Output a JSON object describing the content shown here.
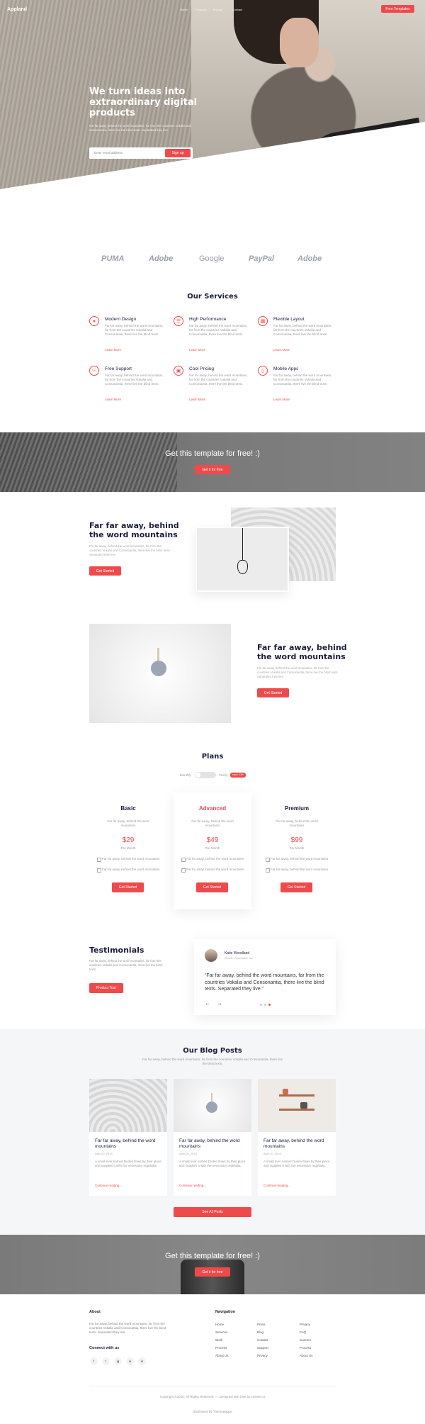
{
  "header": {
    "logo": "Appland",
    "nav": [
      "Home",
      "Features",
      "Pricing",
      "Contact"
    ],
    "cta": "Free Templates"
  },
  "hero": {
    "title": "We turn ideas into extraordinary digital products",
    "subtitle": "Far far away, behind the word mountains, far from the countries Vokalia and Consonantia, there live the blind texts. Separated they live.",
    "email_placeholder": "Enter email address",
    "button": "Sign up"
  },
  "brands": [
    "PUMA",
    "Adobe",
    "Google",
    "PayPal",
    "Adobe"
  ],
  "services": {
    "title": "Our Services",
    "items": [
      {
        "title": "Modern Design",
        "desc": "Far far away, behind the word mountains, far from the countries Vokalia and Consonantia, there live the blind texts.",
        "link": "Learn More"
      },
      {
        "title": "High Performance",
        "desc": "Far far away, behind the word mountains, far from the countries Vokalia and Consonantia, there live the blind texts.",
        "link": "Learn More"
      },
      {
        "title": "Flexible Layout",
        "desc": "Far far away, behind the word mountains, far from the countries Vokalia and Consonantia, there live the blind texts.",
        "link": "Learn More"
      },
      {
        "title": "Free Support",
        "desc": "Far far away, behind the word mountains, far from the countries Vokalia and Consonantia, there live the blind texts.",
        "link": "Learn More"
      },
      {
        "title": "Cool Pricing",
        "desc": "Far far away, behind the word mountains, far from the countries Vokalia and Consonantia, there live the blind texts.",
        "link": "Learn More"
      },
      {
        "title": "Mobile Apps",
        "desc": "Far far away, behind the word mountains, far from the countries Vokalia and Consonantia, there live the blind texts.",
        "link": "Learn More"
      }
    ]
  },
  "cta1": {
    "text": "Get this template for free! :)",
    "button": "Get it for free"
  },
  "feature1": {
    "title": "Far far away, behind the word mountains",
    "desc": "Far far away, behind the word mountains, far from the countries Vokalia and Consonantia, there live the blind texts. Separated they live.",
    "button": "Get Started"
  },
  "feature2": {
    "title": "Far far away, behind the word mountains",
    "desc": "Far far away, behind the word mountains, far from the countries Vokalia and Consonantia, there live the blind texts. Separated they live.",
    "button": "Get Started"
  },
  "plans": {
    "title": "Plans",
    "monthly": "Monthly",
    "yearly": "Yearly",
    "save_badge": "save 20%",
    "items": [
      {
        "name": "Basic",
        "desc": "Far far away, behind the word mountains",
        "price": "$29",
        "per": "Per Month",
        "features": [
          "Far far away, behind the word mountains",
          "Far far away, behind the word mountains"
        ],
        "button": "Get Started"
      },
      {
        "name": "Advanced",
        "desc": "Far far away, behind the word mountains",
        "price": "$49",
        "per": "Per Month",
        "features": [
          "Far far away, behind the word mountains",
          "Far far away, behind the word mountains"
        ],
        "button": "Get Started"
      },
      {
        "name": "Premium",
        "desc": "Far far away, behind the word mountains",
        "price": "$99",
        "per": "Per Month",
        "features": [
          "Far far away, behind the word mountains",
          "Far far away, behind the word mountains"
        ],
        "button": "Get Started"
      }
    ]
  },
  "testimonials": {
    "title": "Testimonials",
    "desc": "Far far away, behind the word mountains, far from the countries Vokalia and Consonantia, there live the blind texts.",
    "button": "Product Tour",
    "name": "Katie Woodland",
    "role": "Owner, Greenland, Inc.",
    "quote": "“Far far away, behind the word mountains, far from the countries Vokalia and Consonantia, there live the blind texts. Separated they live.”"
  },
  "blog": {
    "title": "Our Blog Posts",
    "subtitle": "Far far away, behind the word mountains, far from the countries Vokalia and Consonantia, there live the blind texts.",
    "posts": [
      {
        "title": "Far far away, behind the word mountains",
        "date": "April 20, 2019",
        "desc": "A small river named Duden flows by their place and supplies it with the necessary regelialia.",
        "link": "Continue reading..."
      },
      {
        "title": "Far far away, behind the word mountains",
        "date": "April 20, 2019",
        "desc": "A small river named Duden flows by their place and supplies it with the necessary regelialia.",
        "link": "Continue reading..."
      },
      {
        "title": "Far far away, behind the word mountains",
        "date": "April 20, 2019",
        "desc": "A small river named Duden flows by their place and supplies it with the necessary regelialia.",
        "link": "Continue reading..."
      }
    ],
    "button": "See All Posts"
  },
  "cta2": {
    "text": "Get this template for free! :)",
    "button": "Get it for free"
  },
  "footer": {
    "about_title": "About",
    "about_text": "Far far away, behind the word mountains, far from the countries Vokalia and Consonantia, there live the blind texts. Separated they live.",
    "connect_title": "Connect with us",
    "social": [
      "f",
      "t",
      "ig",
      "in",
      "in"
    ],
    "nav_title": "Navigation",
    "col1": [
      "Home",
      "Services",
      "Work",
      "Process",
      "About Us"
    ],
    "col2": [
      "Press",
      "Blog",
      "Contact",
      "Support",
      "Privacy"
    ],
    "col3": [
      "Privacy",
      "FAQ",
      "Careers",
      "Process",
      "About Us"
    ],
    "copyright": "Copyright ©2020. All Rights Reserved. — Designed with love by Untree.co",
    "distributed": "Distributed by Themewagon"
  },
  "colors": {
    "accent": "#ef4a4b",
    "heading": "#1b1e3b"
  }
}
